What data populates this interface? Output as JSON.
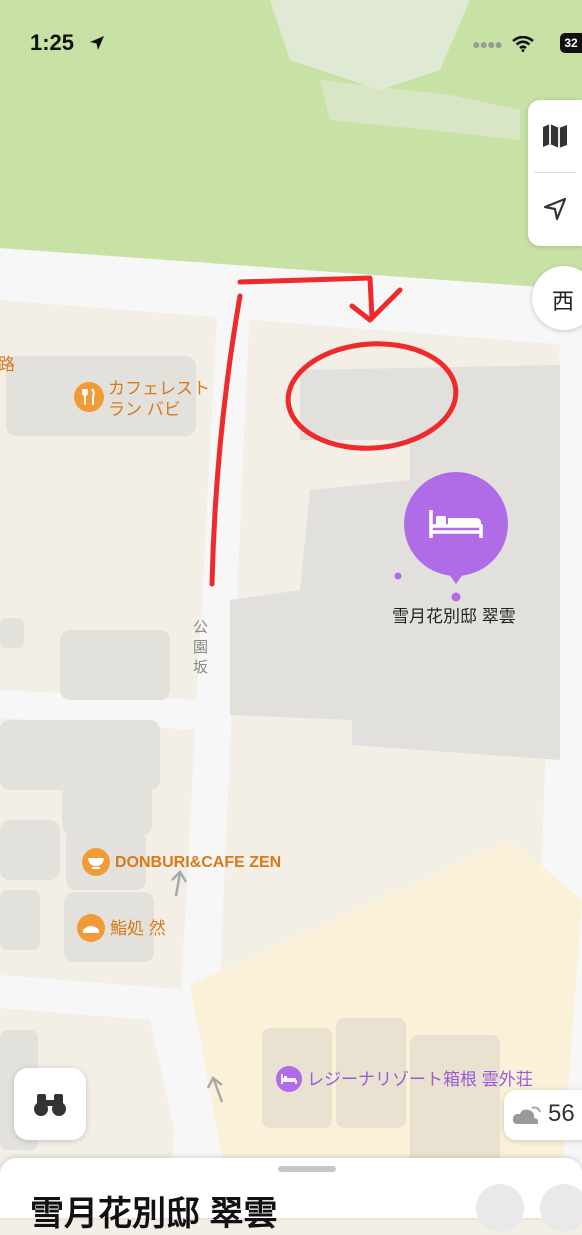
{
  "status_bar": {
    "time": "1:25",
    "battery": "32"
  },
  "map_controls": {
    "map_mode_icon": "map-icon",
    "locate_icon": "location-arrow-icon"
  },
  "compass": {
    "label": "西"
  },
  "map_labels": {
    "road_fragment": "路",
    "cafe": {
      "line1": "カフェレスト",
      "line2": "ラン バビ"
    },
    "street": {
      "c1": "公",
      "c2": "園",
      "c3": "坂"
    },
    "hotel_main": "雪月花別邸 翠雲",
    "donburi": "DONBURI&CAFE ZEN",
    "sushi": "鮨処 然",
    "hotel_second": "レジーナリゾート箱根 雲外荘"
  },
  "weather": {
    "temperature": "56",
    "icon": "partly-cloudy-icon"
  },
  "bottom_sheet": {
    "title": "雪月花別邸 翠雲"
  },
  "colors": {
    "park": "#c8e2a6",
    "road": "#f7f7f7",
    "block": "#ebe7df",
    "poi_orange": "#f19a38",
    "poi_purple": "#b06ce6",
    "annotation": "#ee2a2a"
  }
}
